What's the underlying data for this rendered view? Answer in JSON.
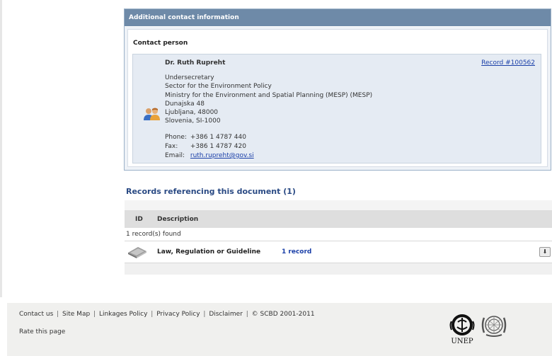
{
  "panel": {
    "header": "Additional contact information",
    "section_title": "Contact person",
    "contact": {
      "name": "Dr. Ruth Rupreht",
      "record_link": "Record #100562",
      "title": "Undersecretary",
      "department": "Sector for the Environment Policy",
      "organization": "Ministry for the Environment and Spatial Planning (MESP) (MESP)",
      "street": "Dunajska 48",
      "city": "Ljubljana, 48000",
      "country": "Slovenia, SI-1000",
      "phone_label": "Phone:",
      "phone": "+386 1 4787 440",
      "fax_label": "Fax:",
      "fax": "+386 1 4787 420",
      "email_label": "Email:",
      "email": "ruth.rupreht@gov.si"
    }
  },
  "records": {
    "title": "Records referencing this document (1)",
    "columns": {
      "id": "ID",
      "description": "Description"
    },
    "found_text": "1 record(s) found",
    "rows": [
      {
        "type": "Law, Regulation or Guideline",
        "count": "1 record",
        "icon": "book-icon"
      }
    ]
  },
  "footer": {
    "links": [
      "Contact us",
      "Site Map",
      "Linkages Policy",
      "Privacy Policy",
      "Disclaimer"
    ],
    "copyright": "© SCBD 2001-2011",
    "rate": "Rate this page",
    "unep_label": "UNEP"
  },
  "colors": {
    "panel_header": "#6e8aa8",
    "contact_box": "#e5ebf3",
    "link": "#1a3fa8",
    "records_title": "#2a4a84"
  }
}
